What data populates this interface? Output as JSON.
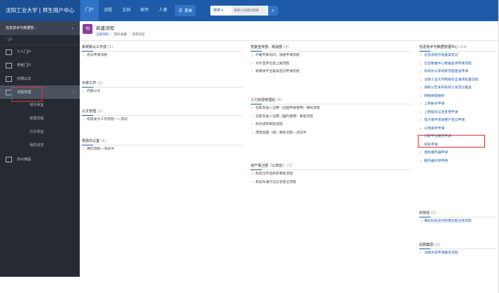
{
  "header": {
    "brand": "沈阳工业大学 | 师生用户中心",
    "nav": [
      "门户",
      "流程",
      "文档",
      "邮件",
      "人事"
    ],
    "menu_icon": "grid-icon",
    "menu_label": "菜单",
    "search_type": "搜搜 ▾",
    "search_placeholder": "请输入关键词搜索",
    "search_icon": "search-icon"
  },
  "sidebar": {
    "header": "信息技术与数据管...",
    "group": "门户",
    "items": [
      {
        "label": "个人门户",
        "icon": "user-icon"
      },
      {
        "label": "学校门户",
        "icon": "home-icon"
      },
      {
        "label": "内部公文",
        "icon": "doc-icon"
      },
      {
        "label": "流程管理",
        "icon": "flow-icon"
      }
    ],
    "subitems": [
      "待办事宜",
      "新建流程",
      "已办事宜",
      "我的请求"
    ],
    "last_item": {
      "label": "办公用品",
      "icon": "box-icon"
    }
  },
  "main": {
    "title": "新建流程",
    "tabs": [
      "全部流程",
      "我的收藏",
      "常用流程"
    ]
  },
  "col1": [
    {
      "title": "系统默认工作流",
      "count": "(1)",
      "links": [
        "会议申请流程"
      ]
    },
    {
      "title": "日常工作",
      "count": "(1)",
      "links": [
        "内部公文"
      ]
    },
    {
      "title": "公文管理",
      "count": "(2)",
      "links": [
        "校级发文工作流程——测试"
      ]
    },
    {
      "title": "党政办公室",
      "count": "(1)",
      "links": [
        "用印流程---测试中"
      ]
    }
  ],
  "col2": [
    {
      "title": "党委宣传部、统战部",
      "count": "(3)",
      "links": [
        "外籍专家访问、讲座申请流程",
        "对外宣传信息上报流程",
        "新媒体平台备案登记申请流程"
      ]
    },
    {
      "title": "人力资源管理处",
      "count": "(4)",
      "links": [
        "在职及收入证明（出国申请使用）审批流程",
        "在职及收入证明（国内使用）审批流程",
        "校内调岗审批流程",
        "借调出国（境）审批流程---测试中"
      ]
    },
    {
      "title": "资产保卫部（公安处）",
      "count": "(2)",
      "links": [
        "危险化学品购买审批流程",
        "机动车通行证信息登记流程"
      ]
    }
  ],
  "col3": [
    {
      "title": "信息技术与数据管理中心",
      "count": "(14)",
      "links": [
        "信息系统开发备案登记",
        "信息数据中心数据查询申请流程",
        "协同办公系统新流程建设申请",
        "沈阳工业大学网络安全事项处置流程",
        "通知公告发布系统人员登记备案",
        "网络故障报修",
        "上网账号申请",
        "上网账号信息变更申请",
        "电子邮件普通用户登记申请",
        "公用邮件申请",
        "创新平台服务申请",
        "域名申请",
        "虚拟服务器申请",
        "服务器托管申请"
      ]
    },
    {
      "title": "科技处",
      "count": "(1)",
      "links": [
        "横向科技合同经费出账出经流程"
      ]
    },
    {
      "title": "后勤集团",
      "count": "(1)",
      "links": [
        "消毒杀虫申请服务流程"
      ]
    }
  ]
}
